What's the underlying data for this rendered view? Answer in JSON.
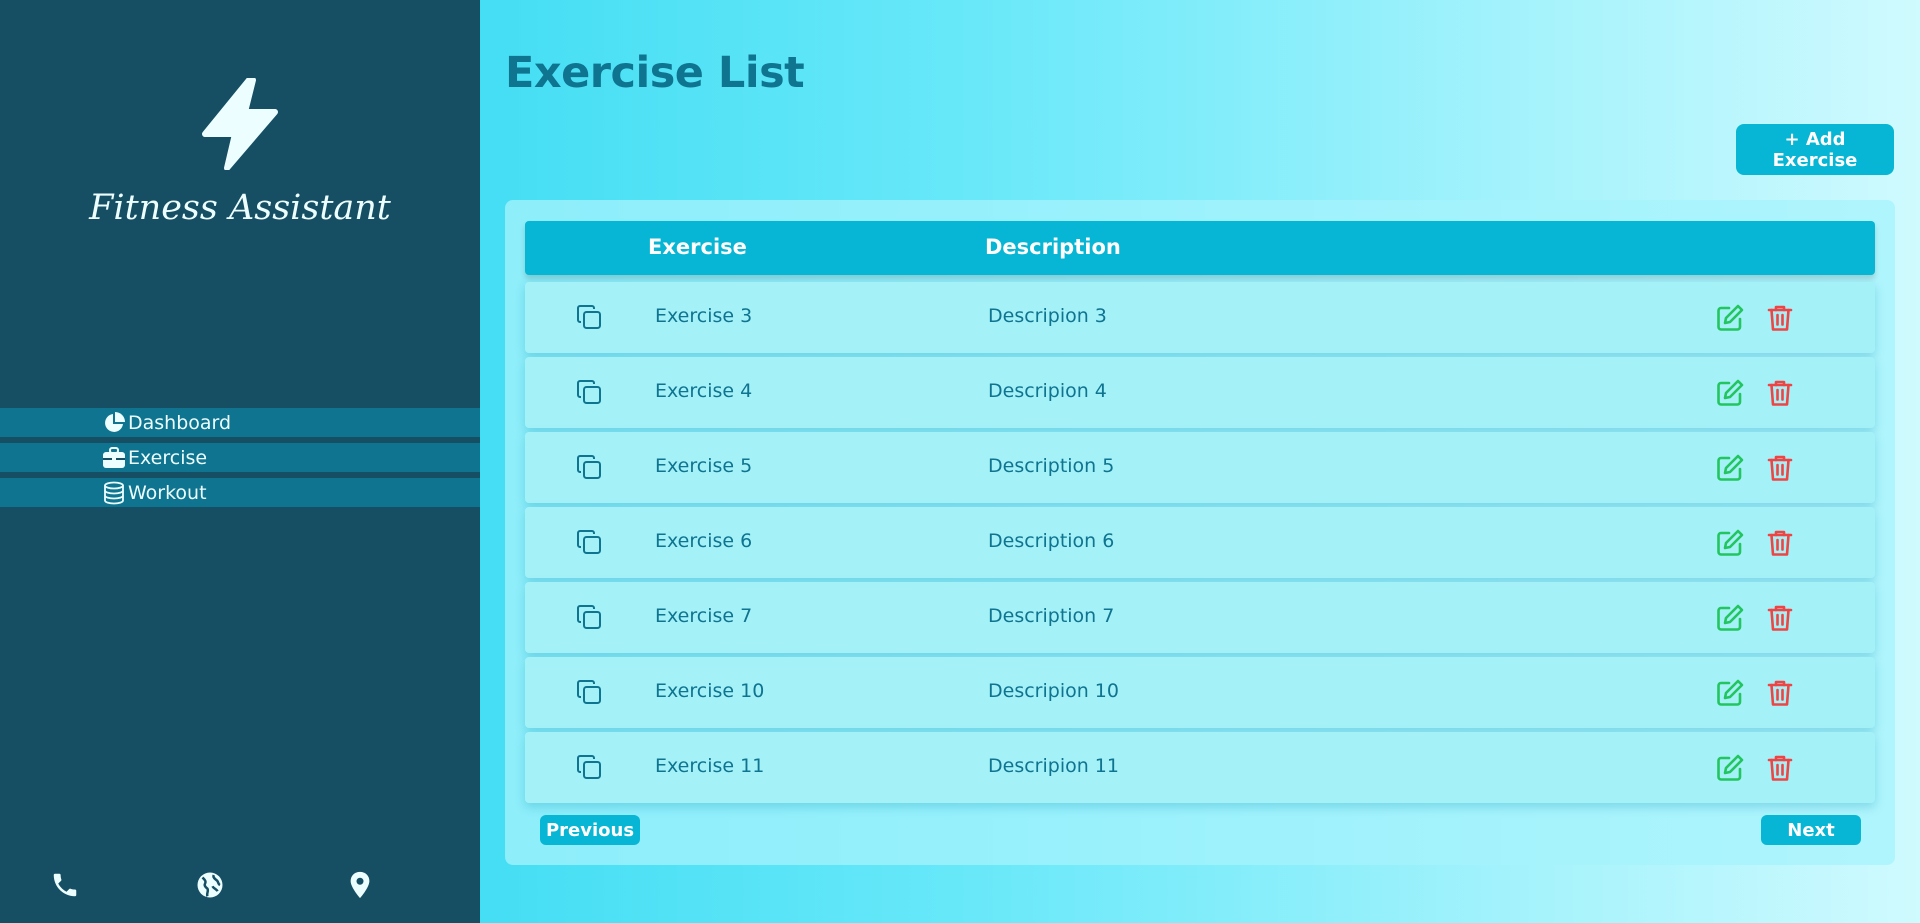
{
  "app": {
    "brand": "Fitness Assistant"
  },
  "sidebar": {
    "items": [
      {
        "label": "Dashboard",
        "icon": "pie-chart-icon"
      },
      {
        "label": "Exercise",
        "icon": "briefcase-icon"
      },
      {
        "label": "Workout",
        "icon": "database-icon"
      }
    ],
    "footer_icons": [
      "phone-icon",
      "globe-icon",
      "location-pin-icon"
    ]
  },
  "main": {
    "title": "Exercise List",
    "add_button_label": "+ Add Exercise",
    "table": {
      "headers": {
        "exercise": "Exercise",
        "description": "Description"
      },
      "rows": [
        {
          "exercise": "Exercise 3",
          "description": "Descripion 3"
        },
        {
          "exercise": "Exercise 4",
          "description": "Descripion 4"
        },
        {
          "exercise": "Exercise 5",
          "description": "Description 5"
        },
        {
          "exercise": "Exercise 6",
          "description": "Description 6"
        },
        {
          "exercise": "Exercise 7",
          "description": "Description 7"
        },
        {
          "exercise": "Exercise 10",
          "description": "Descripion 10"
        },
        {
          "exercise": "Exercise 11",
          "description": "Descripion 11"
        }
      ]
    },
    "pagination": {
      "previous_label": "Previous",
      "next_label": "Next"
    }
  },
  "colors": {
    "sidebar_bg": "#164e63",
    "nav_item_bg": "#0e7490",
    "accent": "#06b6d4",
    "title_text": "#0e7490",
    "edit_green": "#22c55e",
    "delete_red": "#ef4444"
  }
}
